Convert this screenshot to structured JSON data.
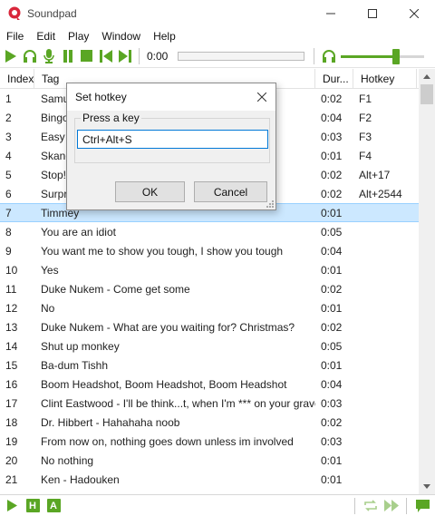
{
  "window": {
    "title": "Soundpad"
  },
  "menu": {
    "items": [
      "File",
      "Edit",
      "Play",
      "Window",
      "Help"
    ]
  },
  "toolbar": {
    "time": "0:00",
    "progress": 0.0,
    "volume": 0.68
  },
  "table": {
    "headers": {
      "index": "Index",
      "tag": "Tag",
      "duration": "Dur...",
      "hotkey": "Hotkey"
    },
    "selected_index": 6,
    "rows": [
      {
        "index": "1",
        "tag": "Samu",
        "duration": "0:02",
        "hotkey": "F1"
      },
      {
        "index": "2",
        "tag": "Bingo",
        "duration": "0:04",
        "hotkey": "F2"
      },
      {
        "index": "3",
        "tag": "Easy p",
        "duration": "0:03",
        "hotkey": "F3"
      },
      {
        "index": "4",
        "tag": "Skand",
        "duration": "0:01",
        "hotkey": "F4"
      },
      {
        "index": "5",
        "tag": "Stop!",
        "duration": "0:02",
        "hotkey": "Alt+17"
      },
      {
        "index": "6",
        "tag": "Surpr",
        "duration": "0:02",
        "hotkey": "Alt+2544"
      },
      {
        "index": "7",
        "tag": "Timmey",
        "duration": "0:01",
        "hotkey": ""
      },
      {
        "index": "8",
        "tag": "You are an idiot",
        "duration": "0:05",
        "hotkey": ""
      },
      {
        "index": "9",
        "tag": "You want me to show you tough, I show you tough",
        "duration": "0:04",
        "hotkey": ""
      },
      {
        "index": "10",
        "tag": "Yes",
        "duration": "0:01",
        "hotkey": ""
      },
      {
        "index": "11",
        "tag": "Duke Nukem - Come get some",
        "duration": "0:02",
        "hotkey": ""
      },
      {
        "index": "12",
        "tag": "No",
        "duration": "0:01",
        "hotkey": ""
      },
      {
        "index": "13",
        "tag": "Duke Nukem - What are you waiting for? Christmas?",
        "duration": "0:02",
        "hotkey": ""
      },
      {
        "index": "14",
        "tag": "Shut up monkey",
        "duration": "0:05",
        "hotkey": ""
      },
      {
        "index": "15",
        "tag": "Ba-dum Tishh",
        "duration": "0:01",
        "hotkey": ""
      },
      {
        "index": "16",
        "tag": "Boom Headshot, Boom Headshot, Boom Headshot",
        "duration": "0:04",
        "hotkey": ""
      },
      {
        "index": "17",
        "tag": "Clint Eastwood - I'll be think...t, when I'm *** on your grave",
        "duration": "0:03",
        "hotkey": ""
      },
      {
        "index": "18",
        "tag": "Dr. Hibbert - Hahahaha noob",
        "duration": "0:02",
        "hotkey": ""
      },
      {
        "index": "19",
        "tag": "From now on, nothing goes down unless im involved",
        "duration": "0:03",
        "hotkey": ""
      },
      {
        "index": "20",
        "tag": "No nothing",
        "duration": "0:01",
        "hotkey": ""
      },
      {
        "index": "21",
        "tag": "Ken - Hadouken",
        "duration": "0:01",
        "hotkey": ""
      }
    ]
  },
  "bottombar": {
    "h_label": "H",
    "a_label": "A"
  },
  "dialog": {
    "title": "Set hotkey",
    "group_label": "Press a key",
    "hotkey_value": "Ctrl+Alt+S",
    "ok_label": "OK",
    "cancel_label": "Cancel"
  },
  "colors": {
    "accent": "#5aa624",
    "selection": "#cce8ff",
    "logo": "#d9263b"
  }
}
